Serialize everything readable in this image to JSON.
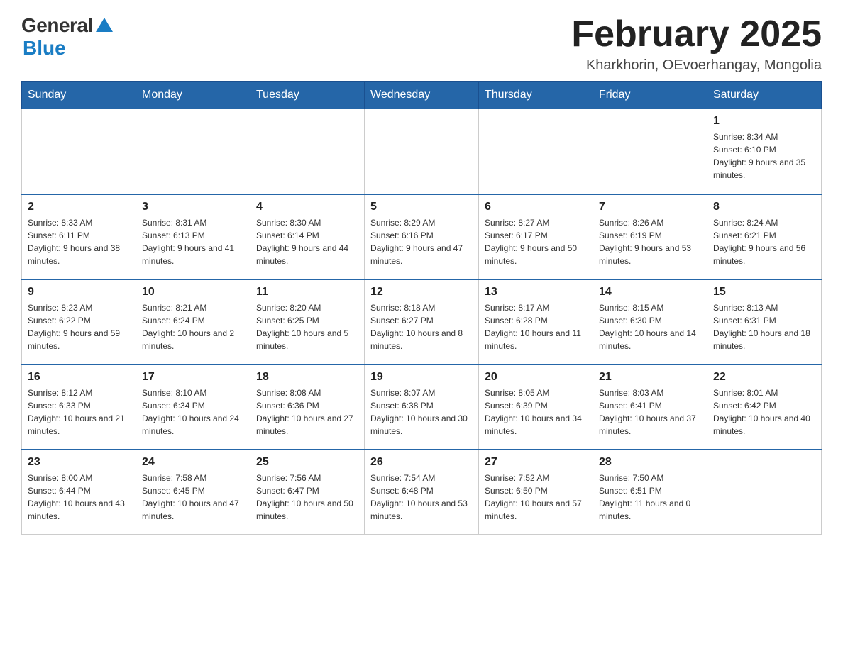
{
  "header": {
    "logo": {
      "general": "General",
      "blue": "Blue"
    },
    "title": "February 2025",
    "subtitle": "Kharkhorin, OEvoerhangay, Mongolia"
  },
  "days_of_week": [
    "Sunday",
    "Monday",
    "Tuesday",
    "Wednesday",
    "Thursday",
    "Friday",
    "Saturday"
  ],
  "weeks": [
    {
      "days": [
        {
          "date": "",
          "info": ""
        },
        {
          "date": "",
          "info": ""
        },
        {
          "date": "",
          "info": ""
        },
        {
          "date": "",
          "info": ""
        },
        {
          "date": "",
          "info": ""
        },
        {
          "date": "",
          "info": ""
        },
        {
          "date": "1",
          "info": "Sunrise: 8:34 AM\nSunset: 6:10 PM\nDaylight: 9 hours and 35 minutes."
        }
      ]
    },
    {
      "days": [
        {
          "date": "2",
          "info": "Sunrise: 8:33 AM\nSunset: 6:11 PM\nDaylight: 9 hours and 38 minutes."
        },
        {
          "date": "3",
          "info": "Sunrise: 8:31 AM\nSunset: 6:13 PM\nDaylight: 9 hours and 41 minutes."
        },
        {
          "date": "4",
          "info": "Sunrise: 8:30 AM\nSunset: 6:14 PM\nDaylight: 9 hours and 44 minutes."
        },
        {
          "date": "5",
          "info": "Sunrise: 8:29 AM\nSunset: 6:16 PM\nDaylight: 9 hours and 47 minutes."
        },
        {
          "date": "6",
          "info": "Sunrise: 8:27 AM\nSunset: 6:17 PM\nDaylight: 9 hours and 50 minutes."
        },
        {
          "date": "7",
          "info": "Sunrise: 8:26 AM\nSunset: 6:19 PM\nDaylight: 9 hours and 53 minutes."
        },
        {
          "date": "8",
          "info": "Sunrise: 8:24 AM\nSunset: 6:21 PM\nDaylight: 9 hours and 56 minutes."
        }
      ]
    },
    {
      "days": [
        {
          "date": "9",
          "info": "Sunrise: 8:23 AM\nSunset: 6:22 PM\nDaylight: 9 hours and 59 minutes."
        },
        {
          "date": "10",
          "info": "Sunrise: 8:21 AM\nSunset: 6:24 PM\nDaylight: 10 hours and 2 minutes."
        },
        {
          "date": "11",
          "info": "Sunrise: 8:20 AM\nSunset: 6:25 PM\nDaylight: 10 hours and 5 minutes."
        },
        {
          "date": "12",
          "info": "Sunrise: 8:18 AM\nSunset: 6:27 PM\nDaylight: 10 hours and 8 minutes."
        },
        {
          "date": "13",
          "info": "Sunrise: 8:17 AM\nSunset: 6:28 PM\nDaylight: 10 hours and 11 minutes."
        },
        {
          "date": "14",
          "info": "Sunrise: 8:15 AM\nSunset: 6:30 PM\nDaylight: 10 hours and 14 minutes."
        },
        {
          "date": "15",
          "info": "Sunrise: 8:13 AM\nSunset: 6:31 PM\nDaylight: 10 hours and 18 minutes."
        }
      ]
    },
    {
      "days": [
        {
          "date": "16",
          "info": "Sunrise: 8:12 AM\nSunset: 6:33 PM\nDaylight: 10 hours and 21 minutes."
        },
        {
          "date": "17",
          "info": "Sunrise: 8:10 AM\nSunset: 6:34 PM\nDaylight: 10 hours and 24 minutes."
        },
        {
          "date": "18",
          "info": "Sunrise: 8:08 AM\nSunset: 6:36 PM\nDaylight: 10 hours and 27 minutes."
        },
        {
          "date": "19",
          "info": "Sunrise: 8:07 AM\nSunset: 6:38 PM\nDaylight: 10 hours and 30 minutes."
        },
        {
          "date": "20",
          "info": "Sunrise: 8:05 AM\nSunset: 6:39 PM\nDaylight: 10 hours and 34 minutes."
        },
        {
          "date": "21",
          "info": "Sunrise: 8:03 AM\nSunset: 6:41 PM\nDaylight: 10 hours and 37 minutes."
        },
        {
          "date": "22",
          "info": "Sunrise: 8:01 AM\nSunset: 6:42 PM\nDaylight: 10 hours and 40 minutes."
        }
      ]
    },
    {
      "days": [
        {
          "date": "23",
          "info": "Sunrise: 8:00 AM\nSunset: 6:44 PM\nDaylight: 10 hours and 43 minutes."
        },
        {
          "date": "24",
          "info": "Sunrise: 7:58 AM\nSunset: 6:45 PM\nDaylight: 10 hours and 47 minutes."
        },
        {
          "date": "25",
          "info": "Sunrise: 7:56 AM\nSunset: 6:47 PM\nDaylight: 10 hours and 50 minutes."
        },
        {
          "date": "26",
          "info": "Sunrise: 7:54 AM\nSunset: 6:48 PM\nDaylight: 10 hours and 53 minutes."
        },
        {
          "date": "27",
          "info": "Sunrise: 7:52 AM\nSunset: 6:50 PM\nDaylight: 10 hours and 57 minutes."
        },
        {
          "date": "28",
          "info": "Sunrise: 7:50 AM\nSunset: 6:51 PM\nDaylight: 11 hours and 0 minutes."
        },
        {
          "date": "",
          "info": ""
        }
      ]
    }
  ]
}
